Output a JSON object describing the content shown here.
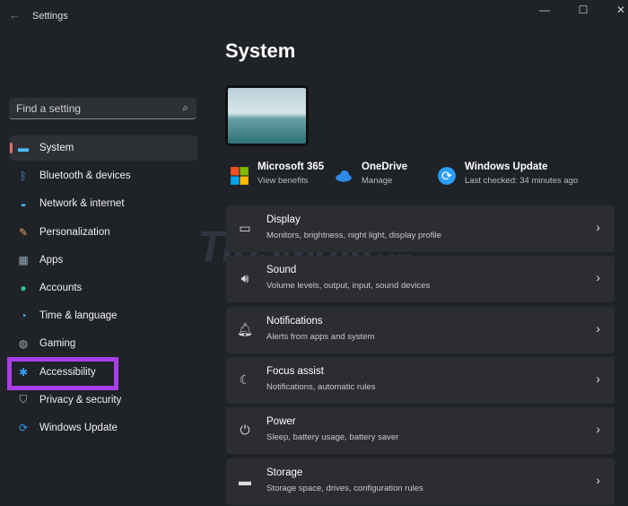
{
  "window": {
    "title": "Settings",
    "back": "←",
    "minimize": "—",
    "maximize": "☐",
    "close": "✕"
  },
  "search": {
    "placeholder": "Find a setting",
    "icon": "search-icon"
  },
  "sidebar": {
    "items": [
      {
        "label": "System",
        "icon": "monitor-icon",
        "color": "#4cc2ff",
        "glyph": "▬"
      },
      {
        "label": "Bluetooth & devices",
        "icon": "bluetooth-icon",
        "color": "#3b9cff",
        "glyph": "ᛒ"
      },
      {
        "label": "Network & internet",
        "icon": "wifi-icon",
        "color": "#4cc2ff",
        "glyph": "◒"
      },
      {
        "label": "Personalization",
        "icon": "brush-icon",
        "color": "#e0a060",
        "glyph": "✎"
      },
      {
        "label": "Apps",
        "icon": "apps-icon",
        "color": "#9ab",
        "glyph": "▦"
      },
      {
        "label": "Accounts",
        "icon": "person-icon",
        "color": "#2ec4a0",
        "glyph": "●"
      },
      {
        "label": "Time & language",
        "icon": "globe-clock-icon",
        "color": "#4cc2ff",
        "glyph": "◔"
      },
      {
        "label": "Gaming",
        "icon": "gamepad-icon",
        "color": "#aaa",
        "glyph": "◍"
      },
      {
        "label": "Accessibility",
        "icon": "accessibility-icon",
        "color": "#3b9cff",
        "glyph": "✱"
      },
      {
        "label": "Privacy & security",
        "icon": "shield-icon",
        "color": "#bbb",
        "glyph": "⛉"
      },
      {
        "label": "Windows Update",
        "icon": "update-icon",
        "color": "#2a9df4",
        "glyph": "⟳"
      }
    ]
  },
  "main": {
    "title": "System",
    "quick": [
      {
        "title": "Microsoft 365",
        "subtitle": "View benefits",
        "icon": "microsoft-logo-icon"
      },
      {
        "title": "OneDrive",
        "subtitle": "Manage",
        "icon": "cloud-icon"
      },
      {
        "title": "Windows Update",
        "subtitle": "Last checked: 34 minutes ago",
        "icon": "update-icon"
      }
    ],
    "cards": [
      {
        "title": "Display",
        "subtitle": "Monitors, brightness, night light, display profile",
        "icon": "laptop-icon",
        "glyph": "▭"
      },
      {
        "title": "Sound",
        "subtitle": "Volume levels, output, input, sound devices",
        "icon": "speaker-icon",
        "glyph": "🔊︎"
      },
      {
        "title": "Notifications",
        "subtitle": "Alerts from apps and system",
        "icon": "bell-icon",
        "glyph": "🔔︎"
      },
      {
        "title": "Focus assist",
        "subtitle": "Notifications, automatic rules",
        "icon": "moon-icon",
        "glyph": "☾"
      },
      {
        "title": "Power",
        "subtitle": "Sleep, battery usage, battery saver",
        "icon": "power-icon",
        "glyph": "⏻"
      },
      {
        "title": "Storage",
        "subtitle": "Storage space, drives, configuration rules",
        "icon": "storage-icon",
        "glyph": "▬"
      }
    ]
  },
  "watermark": "TipsMake.com",
  "highlight_color": "#a93ee8"
}
